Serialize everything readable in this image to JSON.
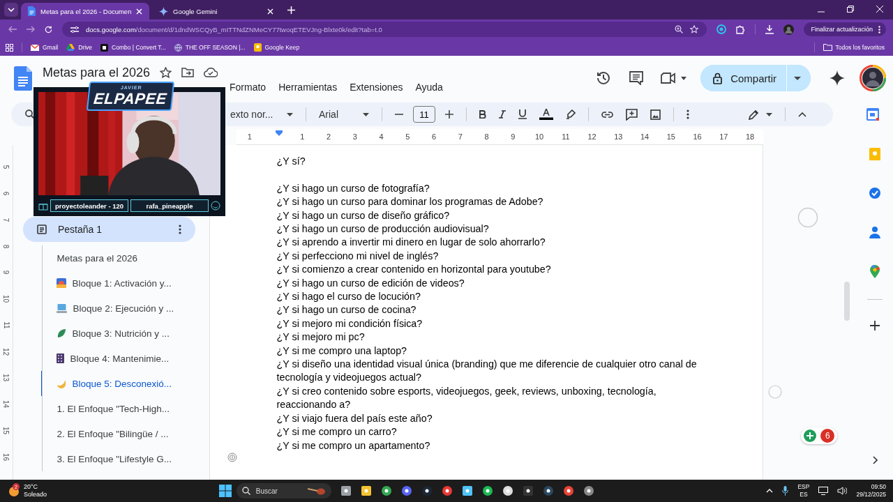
{
  "browser": {
    "tabs": [
      {
        "title": "Metas para el 2026 - Documen",
        "selected": true
      },
      {
        "title": "Google Gemini",
        "selected": false
      }
    ],
    "url": {
      "host": "docs.google.com",
      "path": "/document/d/1dndWSCQyB_mITTNdZNMeCY77twoqETEVJng-Blxte0k/edit?tab=t.0"
    },
    "update_button": "Finalizar actualización",
    "bookmarks": [
      {
        "label": "Gmail"
      },
      {
        "label": "Drive"
      },
      {
        "label": "Combo | Convert T..."
      },
      {
        "label": "THE OFF SEASON |..."
      },
      {
        "label": "Google Keep"
      }
    ],
    "all_bookmarks": "Todos los favoritos"
  },
  "document": {
    "title": "Metas para el 2026",
    "menu": [
      "Formato",
      "Herramientas",
      "Extensiones",
      "Ayuda"
    ],
    "share_button": "Compartir",
    "toolbar": {
      "style": "exto nor...",
      "font": "Arial",
      "font_size": "11"
    },
    "ruler": [
      "1",
      "1",
      "2",
      "3",
      "4",
      "5",
      "6",
      "7",
      "8",
      "9",
      "10",
      "11",
      "12",
      "13",
      "14",
      "15",
      "16",
      "17",
      "18"
    ],
    "vertical_ruler": [
      "5",
      "6",
      "7",
      "8",
      "9",
      "10",
      "11",
      "12",
      "13",
      "14",
      "15",
      "16"
    ],
    "outline": {
      "tab": {
        "label": "Pestaña 1",
        "selected": true
      },
      "items": [
        {
          "label": "Metas para el 2026",
          "selected": false
        },
        {
          "label": "Bloque 1: Activación y...",
          "selected": false
        },
        {
          "label": "Bloque 2: Ejecución y ...",
          "selected": false
        },
        {
          "label": "Bloque 3: Nutrición y ...",
          "selected": false
        },
        {
          "label": "Bloque 4: Mantenimie...",
          "selected": false
        },
        {
          "label": "Bloque 5: Desconexió...",
          "selected": true
        },
        {
          "label": "1. El Enfoque \"Tech-High...",
          "selected": false
        },
        {
          "label": "2. El Enfoque \"Bilingüe / ...",
          "selected": false
        },
        {
          "label": "3. El Enfoque \"Lifestyle G...",
          "selected": false
        }
      ]
    },
    "lead": "¿Y sí?",
    "questions": [
      "¿Y si hago un curso de fotografía?",
      "¿Y si hago un curso para dominar los programas de Adobe?",
      "¿Y si hago un curso de diseño gráfico?",
      "¿Y si hago un curso de producción audiovisual?",
      "¿Y si aprendo a invertir mi dinero en lugar de solo ahorrarlo?",
      "¿Y si perfecciono mi nivel de inglés?",
      "¿Y si comienzo a crear contenido en horizontal para youtube?",
      "¿Y si hago un curso de edición de videos?",
      "¿Y si hago el curso de locución?",
      "¿Y si hago un curso de cocina?",
      "¿Y si mejoro mi condición física?",
      "¿Y si mejoro mi pc?",
      "¿Y si me compro una laptop?",
      "¿Y si diseño una identidad visual única (branding) que me diferencie de cualquier otro canal de tecnología y videojuegos actual?",
      "¿Y si creo contenido sobre esports, videojuegos, geek, reviews, unboxing, tecnología, reaccionando a?",
      "¿Y si viajo fuera del país este año?",
      "¿Y si me compro un carro?",
      "¿Y si me compro un apartamento?"
    ],
    "notification_count": "6"
  },
  "stream_overlay": {
    "logo_top": "JAVIER",
    "logo": "ELPAPEE",
    "names": [
      "proyectoleander - 120",
      "rafa_pineapple"
    ]
  },
  "taskbar": {
    "weather": {
      "temperature": "20°C",
      "condition": "Soleado",
      "badge": "2"
    },
    "search": "Buscar",
    "language": [
      "ESP",
      "ES"
    ],
    "time": "09:50",
    "date": "29/12/2025"
  }
}
